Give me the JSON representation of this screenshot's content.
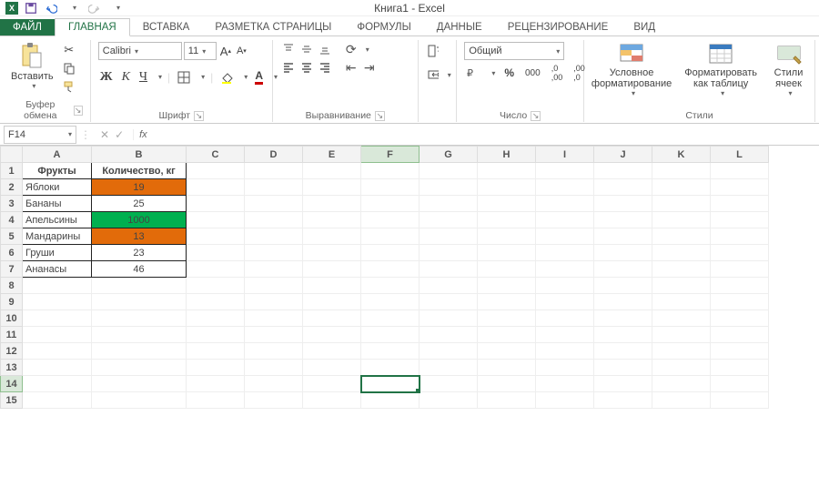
{
  "title": "Книга1 - Excel",
  "qat": {
    "save": "save-icon",
    "undo": "undo-icon",
    "redo": "redo-icon"
  },
  "tabs": {
    "file": "ФАЙЛ",
    "items": [
      "ГЛАВНАЯ",
      "ВСТАВКА",
      "РАЗМЕТКА СТРАНИЦЫ",
      "ФОРМУЛЫ",
      "ДАННЫЕ",
      "РЕЦЕНЗИРОВАНИЕ",
      "ВИД"
    ],
    "active_index": 0
  },
  "ribbon": {
    "clipboard": {
      "label": "Буфер обмена",
      "paste": "Вставить"
    },
    "font": {
      "label": "Шрифт",
      "name": "Calibri",
      "size": "11",
      "bold": "Ж",
      "italic": "К",
      "underline": "Ч"
    },
    "alignment": {
      "label": "Выравнивание"
    },
    "number": {
      "label": "Число",
      "format": "Общий"
    },
    "styles": {
      "label": "Стили",
      "cond": "Условное форматирование",
      "table": "Форматировать как таблицу",
      "cell": "Стили ячеек"
    }
  },
  "formula_bar": {
    "name_box": "F14",
    "fx": "fx"
  },
  "columns": [
    "A",
    "B",
    "C",
    "D",
    "E",
    "F",
    "G",
    "H",
    "I",
    "J",
    "K",
    "L"
  ],
  "row_count": 15,
  "selected": {
    "col": "F",
    "row": 14
  },
  "data": {
    "headers": [
      "Фрукты",
      "Количество, кг"
    ],
    "rows": [
      {
        "name": "Яблоки",
        "qty": "19",
        "fill": "orange"
      },
      {
        "name": "Бананы",
        "qty": "25",
        "fill": ""
      },
      {
        "name": "Апельсины",
        "qty": "1000",
        "fill": "green"
      },
      {
        "name": "Мандарины",
        "qty": "13",
        "fill": "orange"
      },
      {
        "name": "Груши",
        "qty": "23",
        "fill": ""
      },
      {
        "name": "Ананасы",
        "qty": "46",
        "fill": ""
      }
    ]
  },
  "chart_data": {
    "type": "table",
    "title": "",
    "columns": [
      "Фрукты",
      "Количество, кг"
    ],
    "rows": [
      [
        "Яблоки",
        19
      ],
      [
        "Бананы",
        25
      ],
      [
        "Апельсины",
        1000
      ],
      [
        "Мандарины",
        13
      ],
      [
        "Груши",
        23
      ],
      [
        "Ананасы",
        46
      ]
    ]
  }
}
